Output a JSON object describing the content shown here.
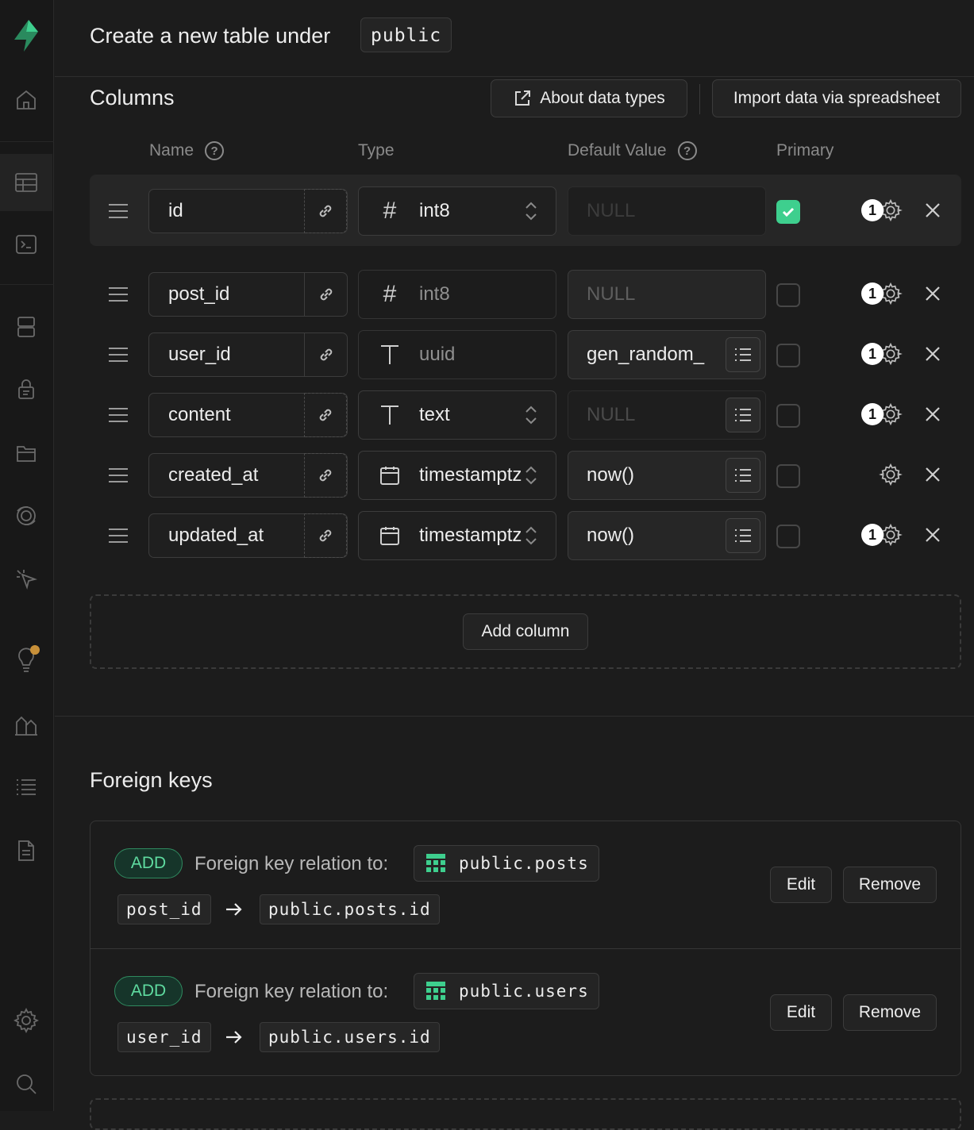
{
  "header": {
    "title": "Create a new table under",
    "schema": "public"
  },
  "columns_section": {
    "title": "Columns",
    "about_types_label": "About data types",
    "import_label": "Import data via spreadsheet",
    "headers": {
      "name": "Name",
      "type": "Type",
      "default": "Default Value",
      "primary": "Primary"
    },
    "help_glyph": "?",
    "rows": [
      {
        "name": "id",
        "type": "int8",
        "type_icon": "hash-icon",
        "default": "NULL",
        "default_is_placeholder": true,
        "primary": true,
        "badge": "1"
      },
      {
        "name": "post_id",
        "type": "int8",
        "type_icon": "hash-icon",
        "default": "NULL",
        "default_is_placeholder": true,
        "primary": false,
        "badge": "1"
      },
      {
        "name": "user_id",
        "type": "uuid",
        "type_icon": "text-icon",
        "default": "gen_random_",
        "default_is_placeholder": false,
        "primary": false,
        "badge": "1"
      },
      {
        "name": "content",
        "type": "text",
        "type_icon": "text-icon",
        "default": "NULL",
        "default_is_placeholder": true,
        "primary": false,
        "badge": "1"
      },
      {
        "name": "created_at",
        "type": "timestamptz",
        "type_icon": "calendar-icon",
        "default": "now()",
        "default_is_placeholder": false,
        "primary": false,
        "badge": ""
      },
      {
        "name": "updated_at",
        "type": "timestamptz",
        "type_icon": "calendar-icon",
        "default": "now()",
        "default_is_placeholder": false,
        "primary": false,
        "badge": "1"
      }
    ],
    "add_column_label": "Add column"
  },
  "foreign_keys": {
    "title": "Foreign keys",
    "relations": [
      {
        "tag": "ADD",
        "label": "Foreign key relation to:",
        "table": "public.posts",
        "from": "post_id",
        "to": "public.posts.id",
        "edit_label": "Edit",
        "remove_label": "Remove"
      },
      {
        "tag": "ADD",
        "label": "Foreign key relation to:",
        "table": "public.users",
        "from": "user_id",
        "to": "public.users.id",
        "edit_label": "Edit",
        "remove_label": "Remove"
      }
    ]
  },
  "colors": {
    "accent": "#3ecf8e",
    "background": "#1c1c1c",
    "notification": "#c89039"
  },
  "sidebar_icons": [
    "supabase-logo-icon",
    "home-icon",
    "table-editor-icon",
    "sql-editor-icon",
    "database-icon",
    "auth-lock-icon",
    "storage-icon",
    "realtime-icon",
    "edge-functions-icon",
    "advisors-bulb-icon",
    "reports-icon",
    "logs-icon",
    "docs-icon",
    "settings-gear-icon",
    "search-icon"
  ]
}
